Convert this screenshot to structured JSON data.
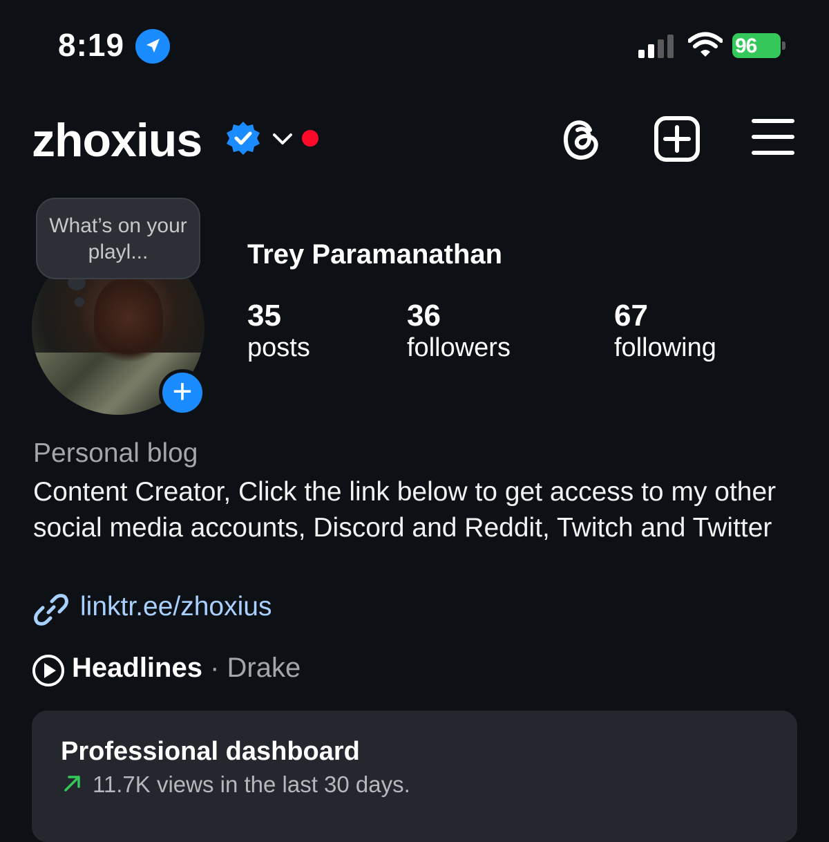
{
  "status_bar": {
    "time": "8:19",
    "battery": "96"
  },
  "header": {
    "username": "zhoxius",
    "icons": [
      "verified-badge-icon",
      "chevron-down-icon",
      "threads-icon",
      "create-post-icon",
      "menu-icon"
    ]
  },
  "profile": {
    "note": "What’s on your playl...",
    "full_name": "Trey Paramanathan",
    "stats": [
      {
        "value": "35",
        "label": "posts"
      },
      {
        "value": "36",
        "label": "followers"
      },
      {
        "value": "67",
        "label": "following"
      }
    ],
    "category": "Personal blog",
    "bio": "Content Creator, Click the link below to get access to my other social media accounts, Discord and Reddit, Twitch and Twitter",
    "link": "linktr.ee/zhoxius",
    "music": {
      "title": "Headlines",
      "separator": "·",
      "artist": "Drake"
    }
  },
  "dashboard": {
    "title": "Professional dashboard",
    "subtitle": "11.7K views in the last 30 days."
  },
  "colors": {
    "background": "#0d1015",
    "accent_blue": "#1a8cff",
    "link": "#a9d1ff",
    "battery_green": "#34c759",
    "notification_red": "#ff0a2b",
    "card": "#24272e"
  }
}
